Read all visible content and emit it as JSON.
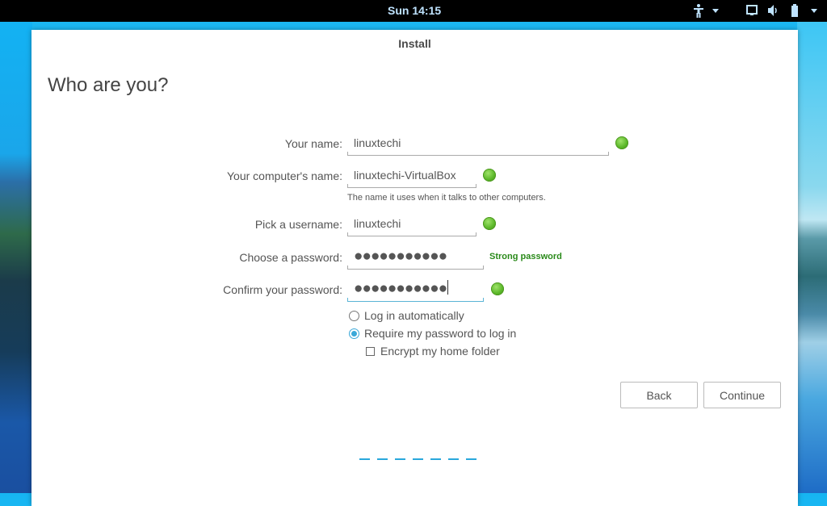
{
  "topbar": {
    "clock": "Sun 14:15",
    "icons": [
      "accessibility-icon",
      "dropdown-arrow-icon",
      "display-icon",
      "volume-icon",
      "battery-icon",
      "system-menu-arrow-icon"
    ]
  },
  "window": {
    "title": "Install",
    "page_title": "Who are you?"
  },
  "form": {
    "name": {
      "label": "Your name:",
      "value": "linuxtechi",
      "status": "valid"
    },
    "computer": {
      "label": "Your computer's name:",
      "value": "linuxtechi-VirtualBox",
      "hint": "The name it uses when it talks to other computers.",
      "status": "valid"
    },
    "username": {
      "label": "Pick a username:",
      "value": "linuxtechi",
      "status": "valid"
    },
    "password": {
      "label": "Choose a password:",
      "masked": "●●●●●●●●●●●",
      "strength": "Strong password"
    },
    "confirm": {
      "label": "Confirm your password:",
      "masked": "●●●●●●●●●●●",
      "status": "valid"
    },
    "login_options": [
      {
        "label": "Log in automatically",
        "selected": false
      },
      {
        "label": "Require my password to log in",
        "selected": true
      }
    ],
    "encrypt": {
      "label": "Encrypt my home folder",
      "checked": false
    }
  },
  "buttons": {
    "back": "Back",
    "continue": "Continue"
  },
  "progress": {
    "total_steps": 7
  },
  "colors": {
    "accent": "#29a8dc",
    "valid": "#5cb82a",
    "strength": "#2a8a1a"
  }
}
